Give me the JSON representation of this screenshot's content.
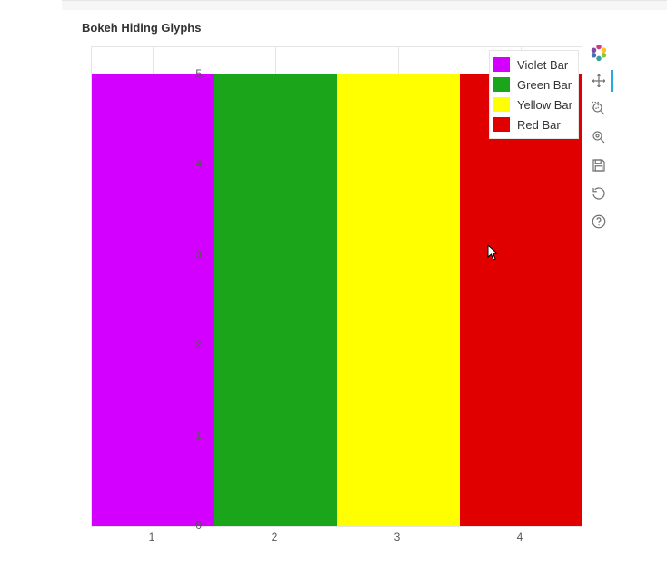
{
  "title": "Bokeh Hiding Glyphs",
  "chart_data": {
    "type": "bar",
    "categories": [
      1,
      2,
      3,
      4
    ],
    "values": [
      5,
      5,
      5,
      5
    ],
    "series_colors": [
      "#d400ff",
      "#1ba51b",
      "#ffff00",
      "#e00000"
    ],
    "series_names": [
      "Violet Bar",
      "Green Bar",
      "Yellow Bar",
      "Red Bar"
    ],
    "xlabel": "",
    "ylabel": "",
    "ylim": [
      0,
      5.3
    ],
    "xlim": [
      0.5,
      4.5
    ],
    "yticks": [
      0,
      1,
      2,
      3,
      4,
      5
    ],
    "xticks": [
      1,
      2,
      3,
      4
    ],
    "bar_width": 1.0,
    "legend_position": "top-right"
  },
  "legend": {
    "items": [
      {
        "label": "Violet Bar",
        "color": "#d400ff"
      },
      {
        "label": "Green Bar",
        "color": "#1ba51b"
      },
      {
        "label": "Yellow Bar",
        "color": "#ffff00"
      },
      {
        "label": "Red Bar",
        "color": "#e00000"
      }
    ]
  },
  "yticks": {
    "t0": "0",
    "t1": "1",
    "t2": "2",
    "t3": "3",
    "t4": "4",
    "t5": "5"
  },
  "xticks": {
    "t1": "1",
    "t2": "2",
    "t3": "3",
    "t4": "4"
  },
  "toolbar": {
    "logo": "bokeh-logo",
    "pan": "pan-tool",
    "boxzoom": "box-zoom-tool",
    "wheelzoom": "wheel-zoom-tool",
    "save": "save-tool",
    "reset": "reset-tool",
    "help": "help-tool"
  }
}
